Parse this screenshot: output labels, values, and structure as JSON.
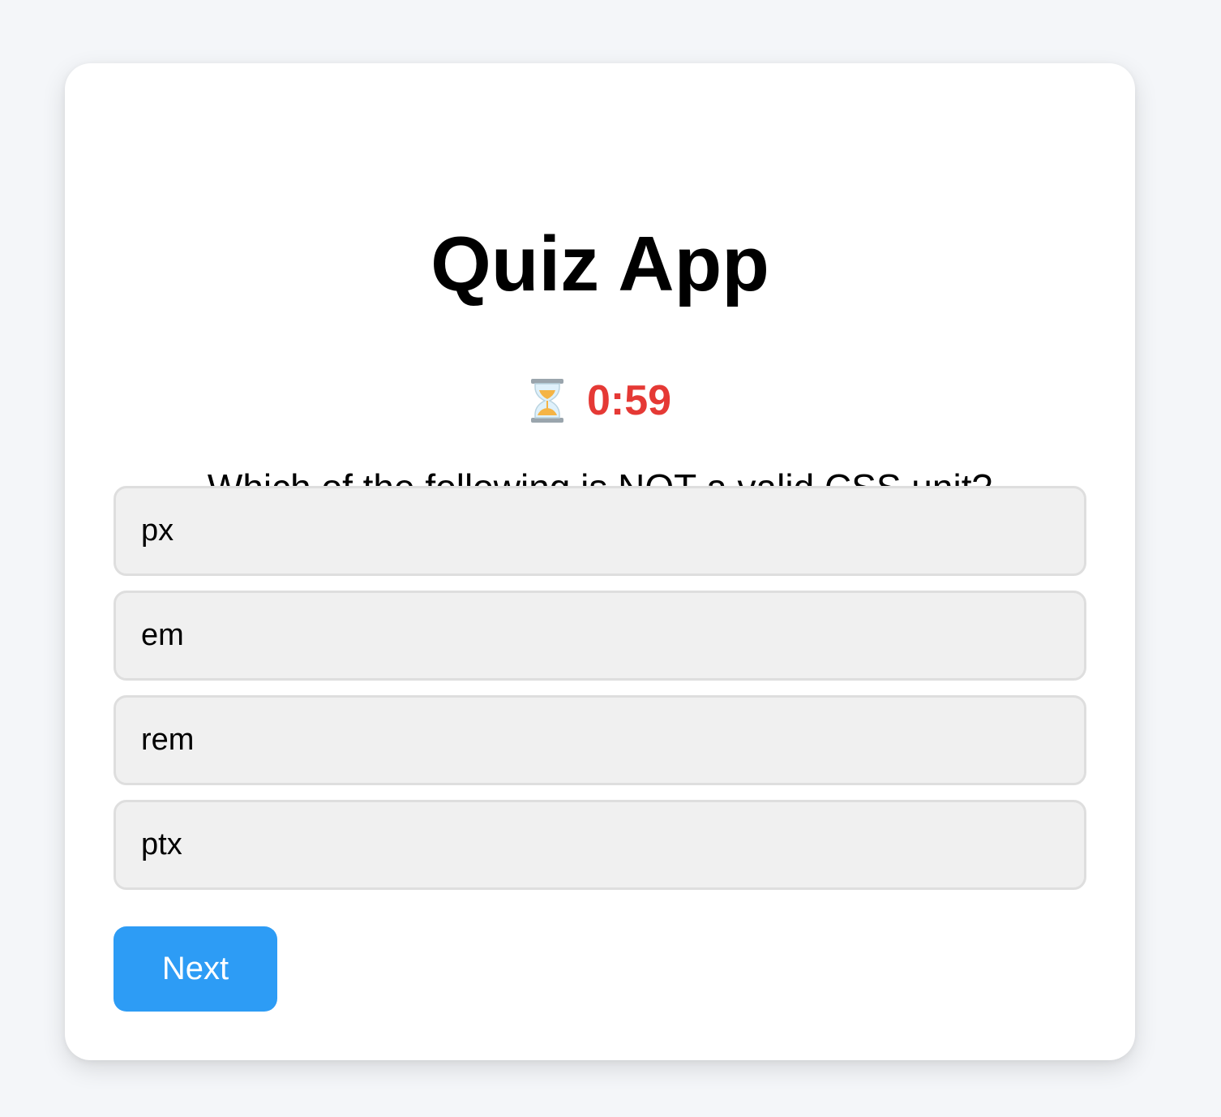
{
  "app": {
    "title": "Quiz App"
  },
  "timer": {
    "icon": "hourglass-icon",
    "value": "0:59",
    "color": "#e53935"
  },
  "question": {
    "text": "Which of the following is NOT a valid CSS unit?",
    "options": [
      {
        "label": "px"
      },
      {
        "label": "em"
      },
      {
        "label": "rem"
      },
      {
        "label": "ptx"
      }
    ]
  },
  "controls": {
    "next_label": "Next",
    "accent_color": "#2d9cf5"
  }
}
